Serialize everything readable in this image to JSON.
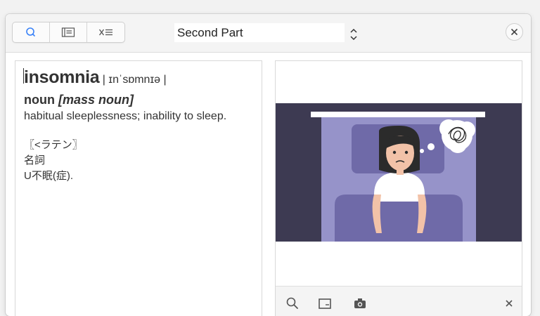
{
  "toolbar": {
    "tabs": [
      {
        "icon": "search-icon",
        "active": true
      },
      {
        "icon": "sidebar-list-icon",
        "active": false
      },
      {
        "icon": "close-list-icon",
        "active": false
      }
    ],
    "section_select": {
      "value": "Second Part"
    },
    "close_icon": "close-icon"
  },
  "definition": {
    "headword": "insomnia",
    "pronunciation": "| ɪnˈsɒmnɪə |",
    "pos": "noun",
    "grammar": "[mass noun]",
    "gloss": "habitual sleeplessness; inability to sleep.",
    "japanese": {
      "etymology": "〖<ラテン〗",
      "pos": "名詞",
      "gloss": "U不眠(症)."
    }
  },
  "image_panel": {
    "illustration": "person-lying-awake-in-bed-illustration",
    "tools": [
      "zoom-icon",
      "crop-icon",
      "camera-icon",
      "close-icon"
    ]
  },
  "colors": {
    "accent": "#3a82f7",
    "illustration_bg": "#3d3a52",
    "bed": "#9693c9",
    "blanket": "#6f6aa8",
    "hair": "#2b2b2b",
    "skin": "#f2c2a8"
  }
}
